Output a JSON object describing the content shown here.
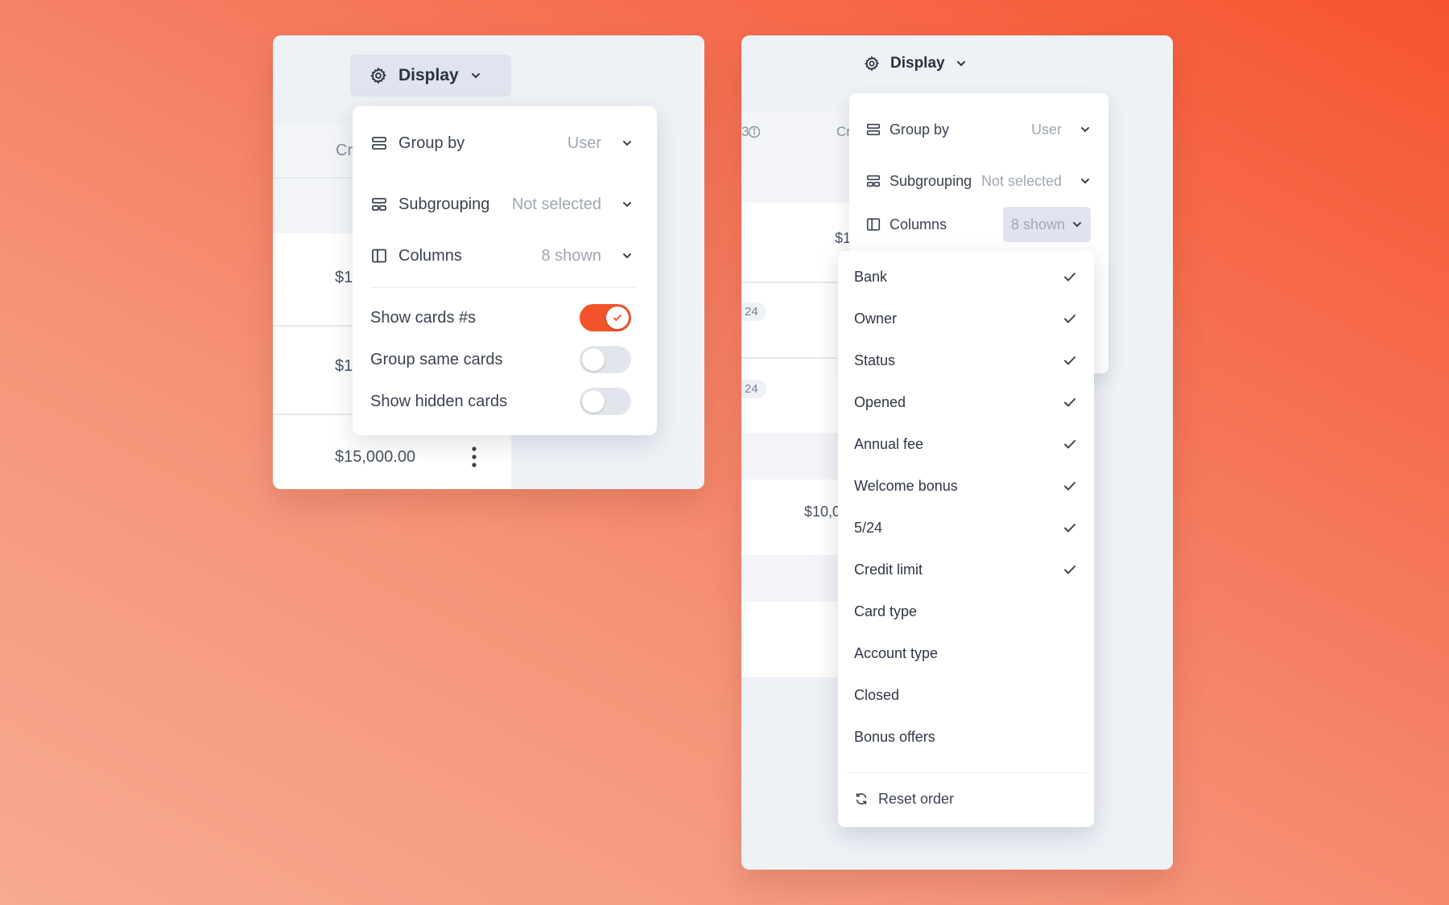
{
  "left": {
    "display_label": "Display",
    "table": {
      "header_fragment": "Cr",
      "row1_amount_fragment": "$1",
      "row2_amount_fragment": "$1",
      "row3_amount": "$15,000.00"
    },
    "menu": {
      "group_by": {
        "label": "Group by",
        "value": "User"
      },
      "subgrouping": {
        "label": "Subgrouping",
        "value": "Not selected"
      },
      "columns": {
        "label": "Columns",
        "value": "8 shown"
      },
      "toggles": [
        {
          "label": "Show cards #s",
          "on": true
        },
        {
          "label": "Group same cards",
          "on": false
        },
        {
          "label": "Show hidden cards",
          "on": false
        }
      ]
    }
  },
  "right": {
    "display_label": "Display",
    "table": {
      "header_fragment_1": "3",
      "header_fragment_2": "Cr",
      "row1_amount_fragment": "$1",
      "badge_1": "24",
      "badge_2": "24",
      "row4_amount_fragment": "$10,0"
    },
    "menu": {
      "group_by": {
        "label": "Group by",
        "value": "User"
      },
      "subgrouping": {
        "label": "Subgrouping",
        "value": "Not selected"
      },
      "columns": {
        "label": "Columns",
        "value": "8 shown"
      }
    },
    "columns_list": [
      {
        "label": "Bank",
        "checked": true
      },
      {
        "label": "Owner",
        "checked": true
      },
      {
        "label": "Status",
        "checked": true
      },
      {
        "label": "Opened",
        "checked": true
      },
      {
        "label": "Annual fee",
        "checked": true
      },
      {
        "label": "Welcome bonus",
        "checked": true
      },
      {
        "label": "5/24",
        "checked": true
      },
      {
        "label": "Credit limit",
        "checked": true
      },
      {
        "label": "Card type",
        "checked": false
      },
      {
        "label": "Account type",
        "checked": false
      },
      {
        "label": "Closed",
        "checked": false
      },
      {
        "label": "Bonus offers",
        "checked": false
      }
    ],
    "reset_label": "Reset order"
  },
  "colors": {
    "accent": "#f2532b",
    "panel_bg": "#eef1f6",
    "muted_text": "#a0a7b3"
  }
}
